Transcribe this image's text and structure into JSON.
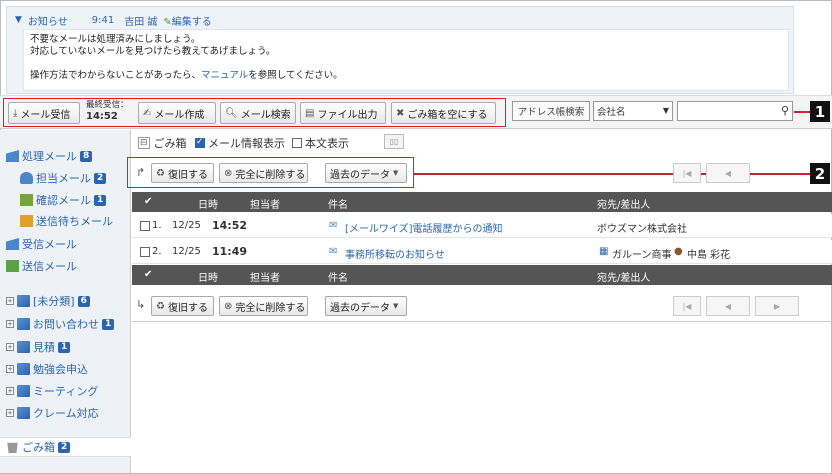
{
  "notice": {
    "title": "お知らせ",
    "time": "9:41",
    "author": "吉田 誠",
    "edit_label": "編集する",
    "line1": "不要なメールは処理済みにしましょう。",
    "line2": "対応していないメールを見つけたら教えてあげましょう。",
    "line3_pre": "操作方法でわからないことがあったら、",
    "line3_link": "マニュアル",
    "line3_post": "を参照してください。"
  },
  "toolbar": {
    "receive_label": "メール受信",
    "last_recv_label": "最終受信：",
    "last_recv_time": "14:52",
    "compose_label": "メール作成",
    "search_label": "メール検索",
    "export_label": "ファイル出力",
    "empty_trash_label": "ごみ箱を空にする",
    "address_search_label": "アドレス帳検索",
    "company_select": "会社名",
    "callout": "1"
  },
  "sidebar": {
    "items": [
      {
        "label": "処理メール",
        "count": "8"
      },
      {
        "label": "担当メール",
        "count": "2"
      },
      {
        "label": "確認メール",
        "count": "1"
      },
      {
        "label": "送信待ちメール",
        "count": ""
      },
      {
        "label": "受信メール",
        "count": ""
      },
      {
        "label": "送信メール",
        "count": ""
      },
      {
        "label": "[未分類]",
        "count": "6"
      },
      {
        "label": "お問い合わせ",
        "count": "1"
      },
      {
        "label": "見積",
        "count": "1"
      },
      {
        "label": "勉強会申込",
        "count": ""
      },
      {
        "label": "ミーティング",
        "count": ""
      },
      {
        "label": "クレーム対応",
        "count": ""
      },
      {
        "label": "ごみ箱",
        "count": "2"
      }
    ]
  },
  "main": {
    "title": "ごみ箱",
    "show_info_label": "メール情報表示",
    "show_body_label": "本文表示",
    "restore_label": "復旧する",
    "delete_label": "完全に削除する",
    "past_data_label": "過去のデータ",
    "callout": "2",
    "columns": {
      "date": "日時",
      "assignee": "担当者",
      "subject": "件名",
      "party": "宛先/差出人"
    },
    "rows": [
      {
        "num": "1.",
        "date": "12/25",
        "time": "14:52",
        "subject": "[メールワイズ]電話履歴からの通知",
        "party": "ボウズマン株式会社",
        "party2": ""
      },
      {
        "num": "2.",
        "date": "12/25",
        "time": "11:49",
        "subject": "事務所移転のお知らせ",
        "party": "ガルーン商事",
        "party2": "中島 彩花"
      }
    ]
  }
}
